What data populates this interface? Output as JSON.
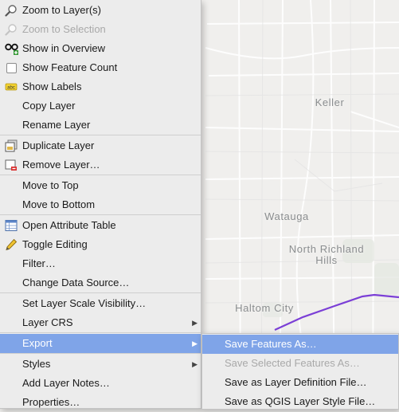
{
  "map": {
    "labels": {
      "keller": "Keller",
      "watauga": "Watauga",
      "north_richland_hills_1": "North Richland",
      "north_richland_hills_2": "Hills",
      "haltom_city": "Haltom City"
    },
    "colors": {
      "background": "#f0efed",
      "roads": "#ffffff",
      "boundary_line": "#7b3fd6",
      "labels": "#8a8d8f"
    }
  },
  "context_menu": {
    "items": [
      {
        "label": "Zoom to Layer(s)",
        "icon": "zoom-icon",
        "enabled": true
      },
      {
        "label": "Zoom to Selection",
        "icon": "zoom-icon",
        "enabled": false
      },
      {
        "label": "Show in Overview",
        "icon": "overview-glasses-icon",
        "enabled": true
      },
      {
        "label": "Show Feature Count",
        "icon": "checkbox",
        "enabled": true
      },
      {
        "label": "Show Labels",
        "icon": "labels-icon",
        "enabled": true
      },
      {
        "label": "Copy Layer",
        "icon": "",
        "enabled": true
      },
      {
        "label": "Rename Layer",
        "icon": "",
        "enabled": true
      },
      {
        "label": "Duplicate Layer",
        "icon": "duplicate-layer-icon",
        "enabled": true
      },
      {
        "label": "Remove Layer…",
        "icon": "remove-layer-icon",
        "enabled": true
      },
      {
        "label": "Move to Top",
        "icon": "",
        "enabled": true
      },
      {
        "label": "Move to Bottom",
        "icon": "",
        "enabled": true
      },
      {
        "label": "Open Attribute Table",
        "icon": "attribute-table-icon",
        "enabled": true
      },
      {
        "label": "Toggle Editing",
        "icon": "pencil-icon",
        "enabled": true
      },
      {
        "label": "Filter…",
        "icon": "",
        "enabled": true
      },
      {
        "label": "Change Data Source…",
        "icon": "",
        "enabled": true
      },
      {
        "label": "Set Layer Scale Visibility…",
        "icon": "",
        "enabled": true
      },
      {
        "label": "Layer CRS",
        "icon": "",
        "enabled": true,
        "submenu": true
      },
      {
        "label": "Export",
        "icon": "",
        "enabled": true,
        "submenu": true,
        "highlighted": true
      },
      {
        "label": "Styles",
        "icon": "",
        "enabled": true,
        "submenu": true
      },
      {
        "label": "Add Layer Notes…",
        "icon": "",
        "enabled": true
      },
      {
        "label": "Properties…",
        "icon": "",
        "enabled": true
      }
    ],
    "highlight_color": "#7fa4e8"
  },
  "export_submenu": {
    "items": [
      {
        "label": "Save Features As…",
        "enabled": true,
        "highlighted": true
      },
      {
        "label": "Save Selected Features As…",
        "enabled": false
      },
      {
        "label": "Save as Layer Definition File…",
        "enabled": true
      },
      {
        "label": "Save as QGIS Layer Style File…",
        "enabled": true
      }
    ]
  }
}
